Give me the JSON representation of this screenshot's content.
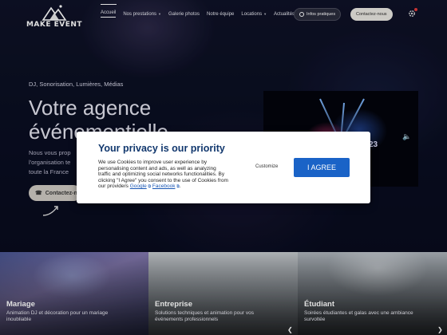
{
  "brand": {
    "logo_text": "MAKE EVENT"
  },
  "nav": {
    "items": [
      {
        "label": "Accueil",
        "dropdown": false,
        "active": true
      },
      {
        "label": "Nos prestations",
        "dropdown": true,
        "active": false
      },
      {
        "label": "Galerie photos",
        "dropdown": false,
        "active": false
      },
      {
        "label": "Notre équipe",
        "dropdown": false,
        "active": false
      },
      {
        "label": "Locations",
        "dropdown": true,
        "active": false
      },
      {
        "label": "Actualités",
        "dropdown": false,
        "active": false
      }
    ],
    "infos_label": "Infos pratiques",
    "contact_label": "Contactez-nous"
  },
  "hero": {
    "tagline": "DJ, Sonorisation, Lumières, Médias",
    "headline_1": "Votre agence",
    "headline_2": "événementielle",
    "body_1": "Nous vous prop",
    "body_2": "l'organisation te",
    "body_3": "toute la France",
    "cta_label": "Contactez-n",
    "video_overlay_text": "23"
  },
  "privacy": {
    "title": "Your privacy is our priority",
    "text": "We use Cookies to improve user experience by personalising content and ads, as well as analyzing traffic and optimizing social networks functionalities. By clicking \"I Agree\" you consent to the use of Cookies from our providers",
    "link_google": "Google",
    "link_facebook": "Facebook",
    "customize_label": "Customize",
    "agree_label": "I AGREE"
  },
  "cards": [
    {
      "title": "Mariage",
      "subtitle": "Animation DJ et décoration pour un mariage inoubliable"
    },
    {
      "title": "Entreprise",
      "subtitle": "Solutions techniques et animation pour vos événements professionnels"
    },
    {
      "title": "Étudiant",
      "subtitle": "Soirées étudiantes et galas avec une ambiance survoltée"
    }
  ],
  "colors": {
    "privacy_title": "#12386e",
    "agree_button": "#1a63c7",
    "contact_button": "#e9e6e1",
    "notification_dot": "#e23b3b"
  }
}
